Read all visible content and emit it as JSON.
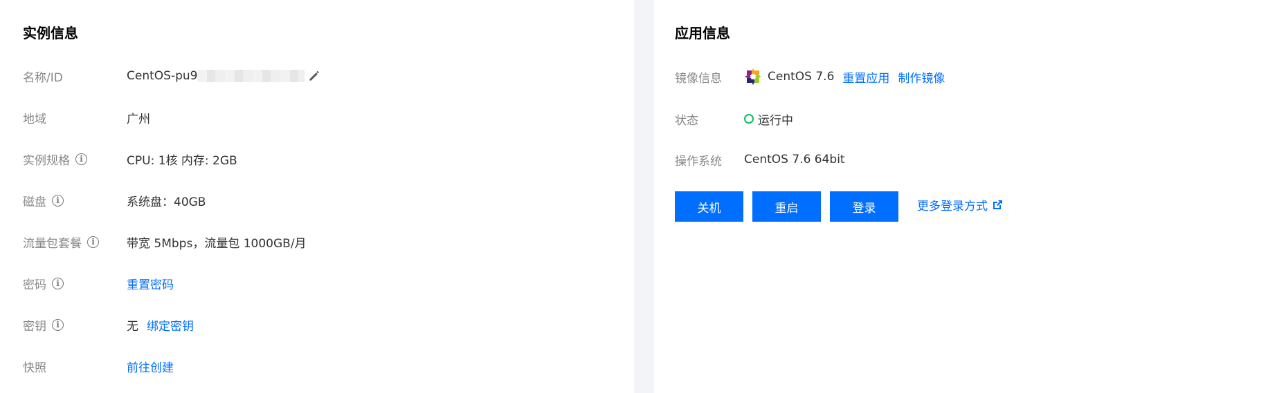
{
  "instance": {
    "title": "实例信息",
    "rows": [
      {
        "label": "名称/ID",
        "value": "CentOS-pu9"
      },
      {
        "label": "地域",
        "value": "广州"
      },
      {
        "label": "实例规格",
        "value": "CPU: 1核 内存: 2GB"
      },
      {
        "label": "磁盘",
        "value": "系统盘：40GB"
      },
      {
        "label": "流量包套餐",
        "value": "带宽 5Mbps，流量包 1000GB/月"
      },
      {
        "label": "密码",
        "value": "重置密码"
      },
      {
        "label": "密钥",
        "value": "无",
        "link": "绑定密钥"
      },
      {
        "label": "快照",
        "value": "前往创建"
      }
    ],
    "info_icon": "i"
  },
  "app": {
    "title": "应用信息",
    "image_label": "镜像信息",
    "image_name": "CentOS 7.6",
    "reset_app": "重置应用",
    "make_image": "制作镜像",
    "status_label": "状态",
    "status_value": "运行中",
    "os_label": "操作系统",
    "os_value": "CentOS 7.6 64bit",
    "buttons": {
      "shutdown": "关机",
      "restart": "重启",
      "login": "登录"
    },
    "more_login": "更多登录方式"
  },
  "colors": {
    "primary": "#006eff",
    "running": "#0abf5b"
  }
}
